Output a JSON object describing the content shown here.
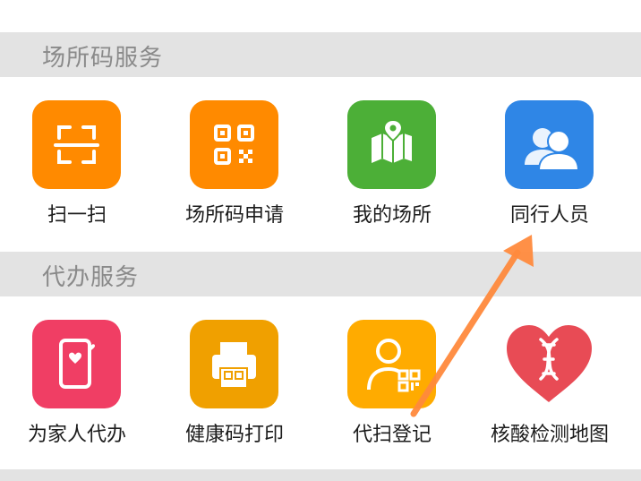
{
  "sections": [
    {
      "title": "场所码服务",
      "items": [
        {
          "label": "扫一扫",
          "icon": "scan-icon",
          "color": "#ff8a00"
        },
        {
          "label": "场所码申请",
          "icon": "qr-code-icon",
          "color": "#ff8a00"
        },
        {
          "label": "我的场所",
          "icon": "map-pin-icon",
          "color": "#4caf37"
        },
        {
          "label": "同行人员",
          "icon": "people-icon",
          "color": "#2f86e6"
        }
      ]
    },
    {
      "title": "代办服务",
      "items": [
        {
          "label": "为家人代办",
          "icon": "phone-heart-icon",
          "color": "#f03e64"
        },
        {
          "label": "健康码打印",
          "icon": "printer-icon",
          "color": "#f0a000"
        },
        {
          "label": "代扫登记",
          "icon": "person-qr-icon",
          "color": "#ffab00"
        },
        {
          "label": "核酸检测地图",
          "icon": "dna-heart-icon",
          "color": "#e84b55"
        }
      ]
    }
  ],
  "annotation": {
    "arrow_color": "#ff8a3d",
    "arrow_icon": "arrow-annotation-icon"
  }
}
